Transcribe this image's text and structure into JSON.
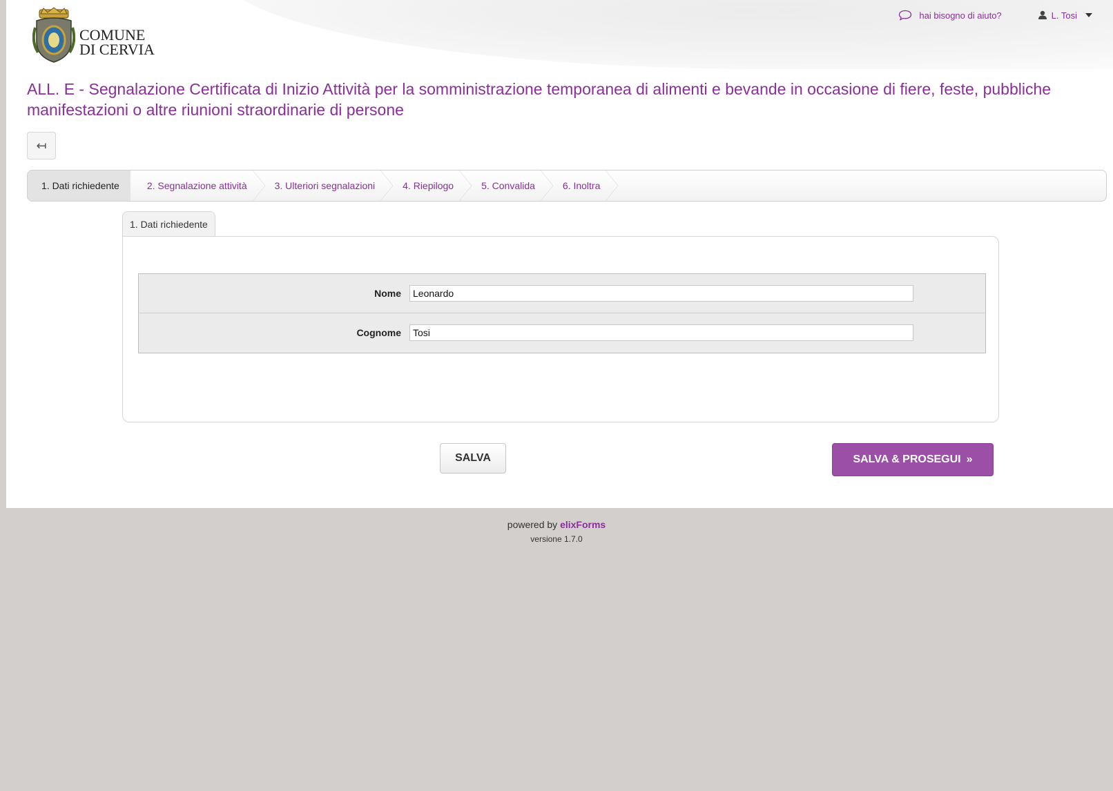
{
  "header": {
    "logo_line1": "COMUNE",
    "logo_line2": "DI CERVIA",
    "help_link": "hai bisogno di aiuto?",
    "user_name": "L. Tosi"
  },
  "page_title": "ALL. E - Segnalazione Certificata di Inizio Attività per la somministrazione temporanea di alimenti e bevande in occasione di fiere, feste, pubbliche manifestazioni o altre riunioni straordinarie di persone",
  "back_button_icon": "arrow-left-icon",
  "wizard_steps": [
    {
      "label": "1. Dati richiedente",
      "active": true
    },
    {
      "label": "2. Segnalazione attività",
      "active": false
    },
    {
      "label": "3. Ulteriori segnalazioni",
      "active": false
    },
    {
      "label": "4. Riepilogo",
      "active": false
    },
    {
      "label": "5. Convalida",
      "active": false
    },
    {
      "label": "6. Inoltra",
      "active": false
    }
  ],
  "form": {
    "tab_label": "1. Dati richiedente",
    "fields": [
      {
        "label": "Nome",
        "value": "Leonardo"
      },
      {
        "label": "Cognome",
        "value": "Tosi"
      }
    ]
  },
  "buttons": {
    "save": "SALVA",
    "save_next": "SALVA & PROSEGUI",
    "save_next_icon": "»"
  },
  "footer": {
    "powered_prefix": "powered by",
    "brand": "elixForms",
    "version": "versione 1.7.0"
  },
  "colors": {
    "accent": "#8a2f9a",
    "primary_button": "#9b4fa7",
    "page_background": "#d3cfcd"
  }
}
